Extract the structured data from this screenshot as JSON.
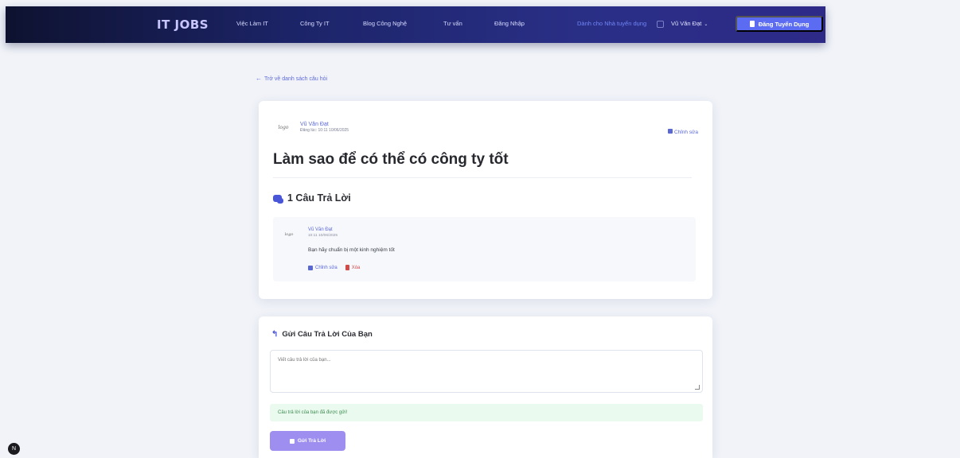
{
  "navbar": {
    "brand": "IT JOBS",
    "links": [
      "Việc Làm IT",
      "Công Ty IT",
      "Blog Công Nghệ",
      "Tư vấn",
      "Đăng Nhập"
    ],
    "employer_link": "Dành cho Nhà tuyển dụng",
    "user_name": "Vũ Văn Đạt",
    "chevron": "⌄",
    "post_job_label": "Đăng Tuyển Dụng"
  },
  "back_link": {
    "arrow": "←",
    "label": "Trở về danh sách câu hỏi"
  },
  "question": {
    "avatar_text": "logo",
    "author": "Vũ Văn Đạt",
    "date": "Đăng lúc: 10:11 10/06/2025",
    "edit_label": "Chỉnh sửa",
    "title": "Làm sao để có thể có công ty tốt"
  },
  "answers": {
    "count_label": "1 Câu Trả Lời",
    "items": [
      {
        "avatar_text": "logo",
        "author": "Vũ Văn Đạt",
        "date": "10:11 10/06/2025",
        "text": "Bạn hãy chuẩn bị một kinh nghiệm tốt",
        "edit_label": "Chỉnh sửa",
        "delete_label": "Xóa"
      }
    ]
  },
  "reply_form": {
    "heading": "Gửi Câu Trả Lời Của Bạn",
    "placeholder": "Viết câu trả lời của bạn...",
    "status_note": "Câu trả lời của bạn đã được gửi!",
    "submit_label": "Gửi Trả Lời"
  },
  "floating_widget": {
    "label": "N"
  },
  "colors": {
    "accent": "#5b6cf2",
    "link": "#5a68d6",
    "submit": "#9d8ef0",
    "success_bg": "#eafaee",
    "danger": "#d24b4b"
  }
}
